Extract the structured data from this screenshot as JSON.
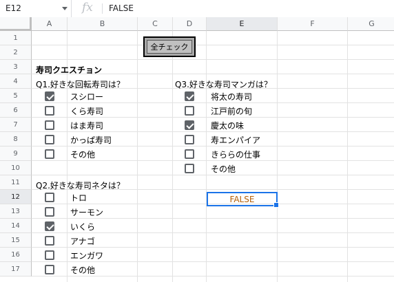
{
  "formula_bar": {
    "cell_ref": "E12",
    "fx_icon": "fx-icon",
    "formula": "FALSE"
  },
  "columns": [
    "A",
    "B",
    "C",
    "D",
    "E",
    "F",
    "G"
  ],
  "rows": [
    "1",
    "2",
    "3",
    "4",
    "5",
    "6",
    "7",
    "8",
    "9",
    "10",
    "11",
    "12",
    "13",
    "14",
    "15",
    "16",
    "17"
  ],
  "active": {
    "column": "E",
    "row": "12"
  },
  "button": {
    "label": "全チェック"
  },
  "title": "寿司クエスチョン",
  "q1": {
    "question": "Q1.好きな回転寿司は？",
    "options": [
      {
        "label": "スシロー",
        "checked": true
      },
      {
        "label": "くら寿司",
        "checked": false
      },
      {
        "label": "はま寿司",
        "checked": false
      },
      {
        "label": "かっぱ寿司",
        "checked": false
      },
      {
        "label": "その他",
        "checked": false
      }
    ]
  },
  "q2": {
    "question": "Q2.好きな寿司ネタは？",
    "options": [
      {
        "label": "トロ",
        "checked": false
      },
      {
        "label": "サーモン",
        "checked": false
      },
      {
        "label": "いくら",
        "checked": true
      },
      {
        "label": "アナゴ",
        "checked": false
      },
      {
        "label": "エンガワ",
        "checked": false
      },
      {
        "label": "その他",
        "checked": false
      }
    ]
  },
  "q3": {
    "question": "Q3.好きな寿司マンガは？",
    "options": [
      {
        "label": "将太の寿司",
        "checked": true
      },
      {
        "label": "江戸前の旬",
        "checked": false
      },
      {
        "label": "慶太の味",
        "checked": true
      },
      {
        "label": "寿エンパイア",
        "checked": false
      },
      {
        "label": "きららの仕事",
        "checked": false
      },
      {
        "label": "その他",
        "checked": false
      }
    ]
  },
  "selected_cell_value": "FALSE",
  "colors": {
    "selection": "#1a73e8",
    "checkbox": "#5f6368",
    "false_text": "#b45f06"
  }
}
